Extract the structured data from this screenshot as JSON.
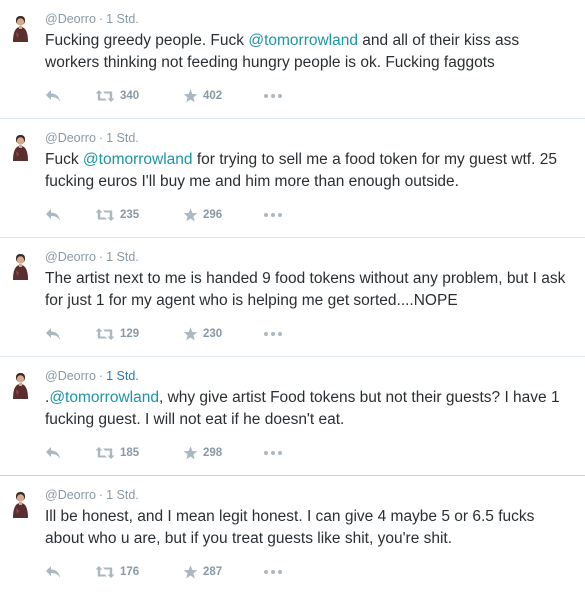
{
  "tweets": [
    {
      "handle": "@Deorro",
      "time": "1 Std.",
      "highlight_time": false,
      "segments": [
        {
          "type": "text",
          "text": "Fucking greedy people. Fuck "
        },
        {
          "type": "mention",
          "text": "@tomorrowland"
        },
        {
          "type": "text",
          "text": " and all of their kiss ass workers thinking not feeding hungry people is ok. Fucking faggots"
        }
      ],
      "retweets": "340",
      "favorites": "402"
    },
    {
      "handle": "@Deorro",
      "time": "1 Std.",
      "highlight_time": false,
      "segments": [
        {
          "type": "text",
          "text": "Fuck "
        },
        {
          "type": "mention",
          "text": "@tomorrowland"
        },
        {
          "type": "text",
          "text": " for trying to sell me a food token for my guest wtf. 25 fucking euros I'll buy me and him more than enough outside."
        }
      ],
      "retweets": "235",
      "favorites": "296"
    },
    {
      "handle": "@Deorro",
      "time": "1 Std.",
      "highlight_time": false,
      "segments": [
        {
          "type": "text",
          "text": "The artist next to me is handed 9 food tokens without any problem, but I ask for just 1 for my agent who is helping me get sorted....NOPE"
        }
      ],
      "retweets": "129",
      "favorites": "230"
    },
    {
      "handle": "@Deorro",
      "time": "1 Std.",
      "highlight_time": true,
      "segments": [
        {
          "type": "text",
          "text": "."
        },
        {
          "type": "mention",
          "text": "@tomorrowland"
        },
        {
          "type": "text",
          "text": ", why give artist Food tokens but not their guests? I have 1 fucking guest. I will not eat if he doesn't eat."
        }
      ],
      "retweets": "185",
      "favorites": "298"
    },
    {
      "handle": "@Deorro",
      "time": "1 Std.",
      "highlight_time": false,
      "segments": [
        {
          "type": "text",
          "text": "Ill be honest, and I mean legit honest. I can give 4 maybe 5 or 6.5 fucks about who u are, but if you treat guests like shit, you're shit."
        }
      ],
      "retweets": "176",
      "favorites": "287"
    }
  ],
  "separator": "·",
  "colors": {
    "mention": "#1b95a8",
    "muted": "#8899a6",
    "icon": "#aab8c2",
    "text": "#292f33",
    "highlighted_time": "#2b7bb9"
  },
  "icons": {
    "reply": "reply-icon",
    "retweet": "retweet-icon",
    "favorite": "star-icon",
    "more": "more-dots-icon"
  }
}
